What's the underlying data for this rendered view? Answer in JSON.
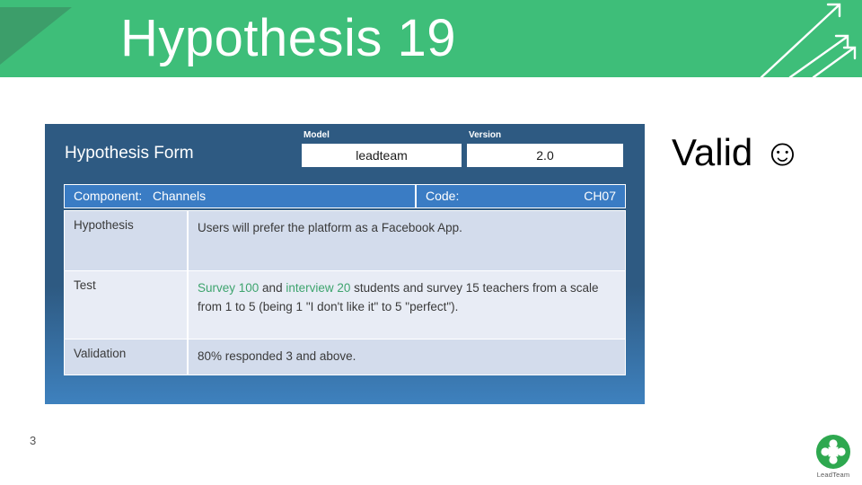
{
  "header": {
    "title": "Hypothesis 19",
    "band_color": "#3EBE79",
    "triangle_color": "#3C9E6A",
    "arrow_icon": "diagonal-growth-arrows"
  },
  "form": {
    "title": "Hypothesis Form",
    "panel_color": "#2E5A82",
    "fields": [
      {
        "label": "Model",
        "value": "leadteam"
      },
      {
        "label": "Version",
        "value": "2.0"
      }
    ],
    "component_bar": {
      "component_label": "Component:",
      "component_value": "Channels",
      "code_label": "Code:",
      "code_value": "CH07",
      "color": "#3A7CC4"
    },
    "rows": [
      {
        "label": "Hypothesis",
        "value": "Users will prefer the platform as a Facebook App."
      },
      {
        "label": "Test",
        "value_parts": [
          {
            "text": "Survey 100",
            "highlight": true
          },
          {
            "text": " and ",
            "highlight": false
          },
          {
            "text": "interview 20",
            "highlight": true
          },
          {
            "text": " students and survey 15 teachers from a scale from 1 to 5 (being 1 \"I don't like it\" to 5 \"perfect\").",
            "highlight": false
          }
        ],
        "highlight_color": "#3EA46E"
      },
      {
        "label": "Validation",
        "value": " 80% responded 3 and above."
      }
    ]
  },
  "verdict": {
    "text": "Valid ☺"
  },
  "footer": {
    "page_number": "3",
    "brand_name": "LeadTeam",
    "brand_color": "#2EA84F",
    "brand_icon": "leadteam-flower-logo"
  }
}
